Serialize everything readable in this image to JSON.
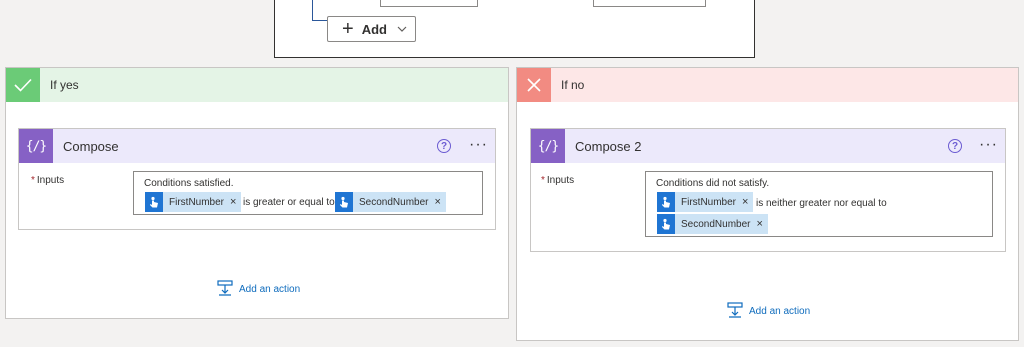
{
  "condition": {
    "add_label": "Add"
  },
  "yes_branch": {
    "title": "If yes",
    "header_color": "#e4f4e6",
    "icon_color": "#6bcb77",
    "compose": {
      "title": "Compose",
      "inputs_label": "Inputs",
      "text_line": "Conditions satisfied.",
      "token1": "FirstNumber",
      "middle_text": "is greater or equal to",
      "token2": "SecondNumber"
    },
    "add_action_label": "Add an action"
  },
  "no_branch": {
    "title": "If no",
    "header_color": "#fde7e7",
    "icon_color": "#f28b82",
    "compose": {
      "title": "Compose 2",
      "inputs_label": "Inputs",
      "text_line": "Conditions did not satisfy.",
      "token1": "FirstNumber",
      "middle_text": "is neither greater nor equal to",
      "token2": "SecondNumber"
    },
    "add_action_label": "Add an action"
  },
  "icons": {
    "check": "check-icon",
    "close": "close-icon",
    "compose": "compose-icon",
    "help": "help-icon",
    "more": "more-options-icon",
    "token": "manual-trigger-icon",
    "add_action": "add-action-icon",
    "plus": "plus-icon",
    "chevron": "chevron-down-icon"
  },
  "colors": {
    "compose_purple": "#8661c5",
    "token_blue": "#1f75d3",
    "token_bg": "#cce3f5",
    "link_blue": "#0f6cbd"
  }
}
